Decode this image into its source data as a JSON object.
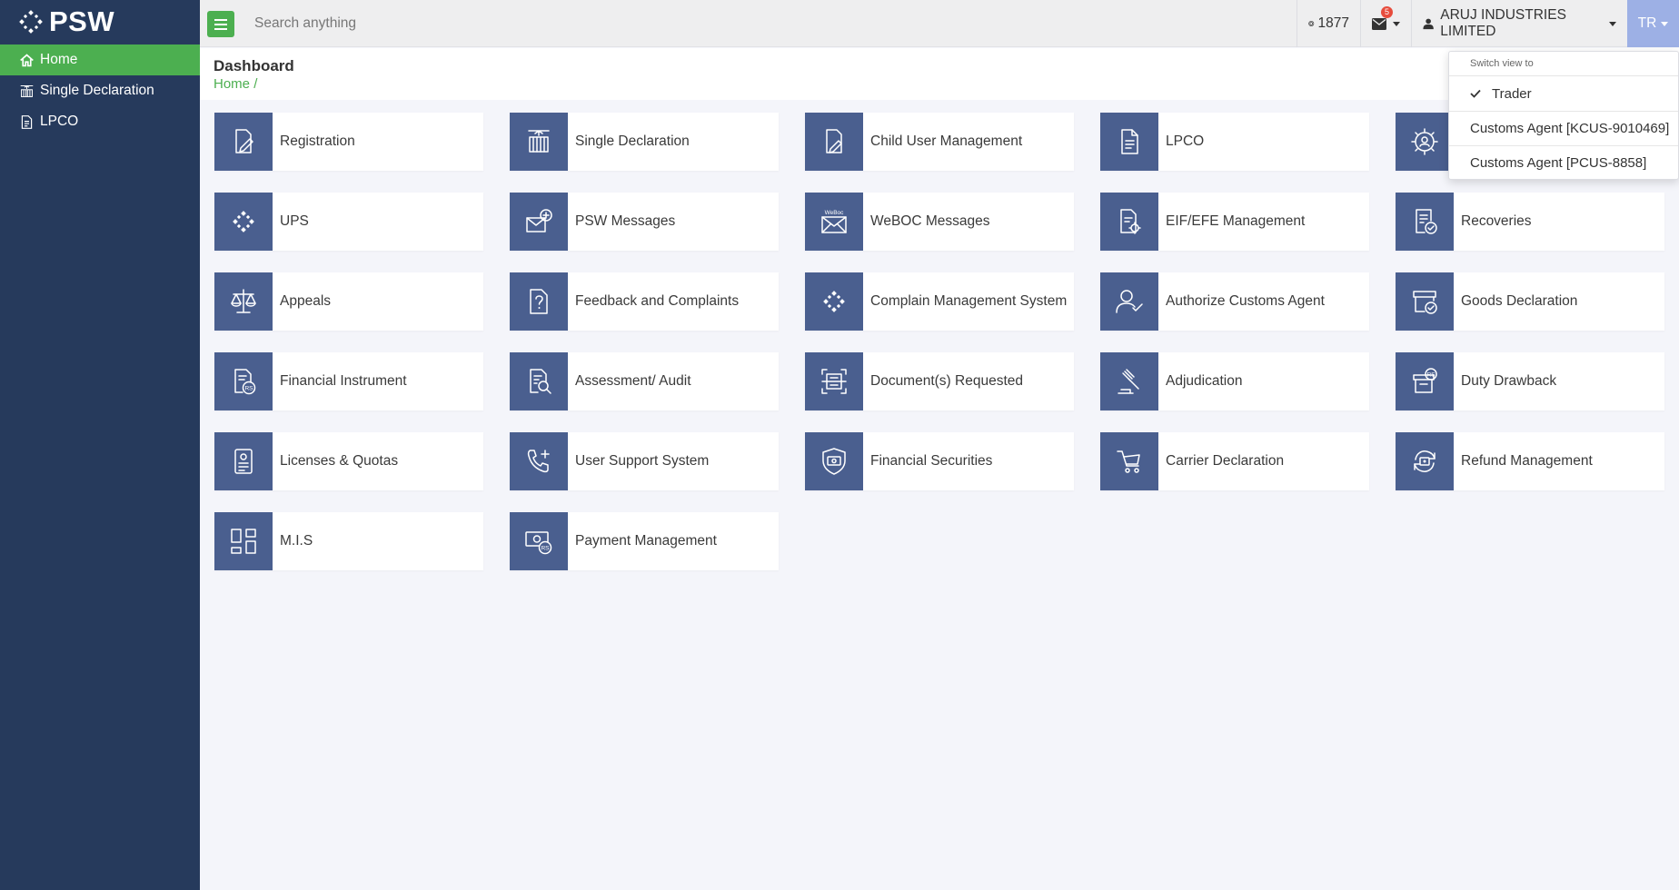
{
  "brand": {
    "name": "PSW"
  },
  "sidebar": {
    "items": [
      {
        "label": "Home",
        "icon": "home-icon",
        "active": true
      },
      {
        "label": "Single Declaration",
        "icon": "container-icon",
        "active": false
      },
      {
        "label": "LPCO",
        "icon": "document-icon",
        "active": false
      }
    ]
  },
  "topbar": {
    "search_placeholder": "Search anything",
    "coins": "1877",
    "mail_badge": "5",
    "user_name": "ARUJ INDUSTRIES LIMITED",
    "view_code": "TR"
  },
  "page": {
    "title": "Dashboard",
    "breadcrumb_home": "Home",
    "breadcrumb_sep": "/"
  },
  "tiles": [
    {
      "label": "Registration",
      "icon": "registration-icon"
    },
    {
      "label": "Single Declaration",
      "icon": "container-crane-icon"
    },
    {
      "label": "Child User Management",
      "icon": "document-edit-icon"
    },
    {
      "label": "LPCO",
      "icon": "document-lines-icon"
    },
    {
      "label": "",
      "icon": "settings-user-icon"
    },
    {
      "label": "UPS",
      "icon": "ups-dots-icon"
    },
    {
      "label": "PSW Messages",
      "icon": "psw-mail-icon"
    },
    {
      "label": "WeBOC Messages",
      "icon": "weboc-mail-icon"
    },
    {
      "label": "EIF/EFE Management",
      "icon": "document-gear-icon"
    },
    {
      "label": "Recoveries",
      "icon": "document-check-icon"
    },
    {
      "label": "Appeals",
      "icon": "scales-icon"
    },
    {
      "label": "Feedback and Complaints",
      "icon": "question-document-icon"
    },
    {
      "label": "Complain Management System",
      "icon": "complain-dots-icon"
    },
    {
      "label": "Authorize Customs Agent",
      "icon": "user-check-icon"
    },
    {
      "label": "Goods Declaration",
      "icon": "box-check-icon"
    },
    {
      "label": "Financial Instrument",
      "icon": "rupee-document-icon"
    },
    {
      "label": "Assessment/ Audit",
      "icon": "document-search-icon"
    },
    {
      "label": "Document(s) Requested",
      "icon": "document-scan-icon"
    },
    {
      "label": "Adjudication",
      "icon": "gavel-icon"
    },
    {
      "label": "Duty Drawback",
      "icon": "rupee-box-icon"
    },
    {
      "label": "Licenses & Quotas",
      "icon": "license-icon"
    },
    {
      "label": "User Support System",
      "icon": "phone-plus-icon"
    },
    {
      "label": "Financial Securities",
      "icon": "shield-money-icon"
    },
    {
      "label": "Carrier Declaration",
      "icon": "cart-icon"
    },
    {
      "label": "Refund Management",
      "icon": "refund-icon"
    },
    {
      "label": "M.I.S",
      "icon": "dashboard-grid-icon"
    },
    {
      "label": "Payment Management",
      "icon": "payment-rupee-icon"
    }
  ],
  "switch_view": {
    "header": "Switch view to",
    "options": [
      {
        "label": "Trader",
        "selected": true
      },
      {
        "label": "Customs Agent [KCUS-9010469]",
        "selected": false
      },
      {
        "label": "Customs Agent [PCUS-8858]",
        "selected": false
      }
    ]
  },
  "colors": {
    "sidebar_bg": "#263a5c",
    "accent_green": "#4caf50",
    "tile_icon_bg": "#4a5f8f",
    "view_badge_bg": "#9db0e5",
    "page_bg": "#f4f5fa"
  }
}
